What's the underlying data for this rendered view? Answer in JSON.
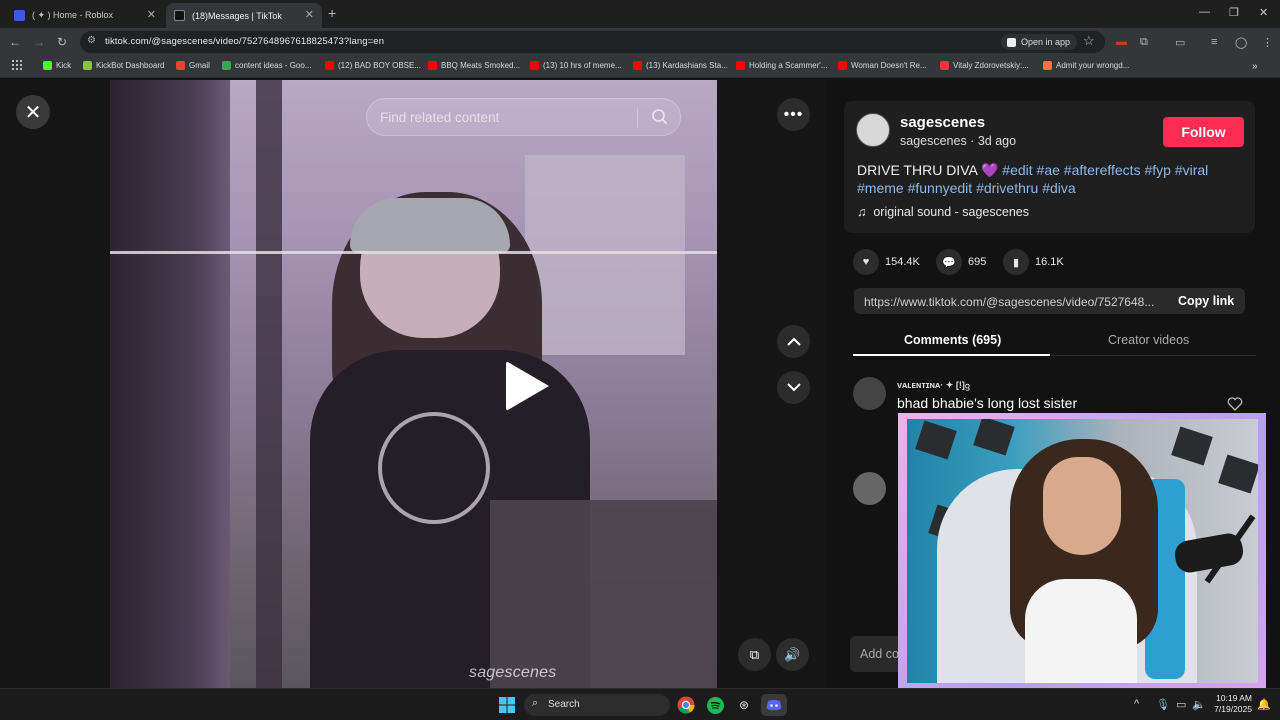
{
  "browser": {
    "tabs": [
      {
        "title": "( ✦ ) Home - Roblox",
        "active": false,
        "favicon_color": "#3b5bdb"
      },
      {
        "title": "(18)Messages | TikTok",
        "active": true,
        "favicon_color": "#111111"
      }
    ],
    "url": "tiktok.com/@sagescenes/video/7527648967618825473?lang=en",
    "open_in_app_label": "Open in app",
    "bookmarks": [
      {
        "label": "Kick",
        "color": "#53fc18"
      },
      {
        "label": "KickBot Dashboard",
        "color": "#8bc34a"
      },
      {
        "label": "Gmail",
        "color": "#ea4335"
      },
      {
        "label": "content ideas - Goo...",
        "color": "#34a853"
      },
      {
        "label": "(12) BAD BOY OBSE...",
        "color": "#ff0000"
      },
      {
        "label": "BBQ Meats Smoked...",
        "color": "#ff0000"
      },
      {
        "label": "(13) 10 hrs of meme...",
        "color": "#ff0000"
      },
      {
        "label": "(13) Kardashians Sta...",
        "color": "#ff0000"
      },
      {
        "label": "Holding a Scammer'...",
        "color": "#ff0000"
      },
      {
        "label": "Woman Doesn't Re...",
        "color": "#ff0000"
      },
      {
        "label": "Vitaly Zdorovetskiy:...",
        "color": "#e53935"
      },
      {
        "label": "Admit your wrongd...",
        "color": "#ff7043"
      }
    ]
  },
  "video": {
    "search_placeholder": "Find related content",
    "watermark": "sagescenes"
  },
  "post": {
    "author": "sagescenes",
    "handle_line": "sagescenes · 3d ago",
    "follow_label": "Follow",
    "caption": "DRIVE THRU DIVA 💜",
    "hashtags_line1": "#edit #ae #aftereffects #fyp #viral",
    "hashtags_line2": "#meme #funnyedit #drivethru #diva",
    "sound": "original sound - sagescenes",
    "likes": "154.4K",
    "comments_count": "695",
    "saves": "16.1K",
    "share_url": "https://www.tiktok.com/@sagescenes/video/7527648...",
    "copy_link_label": "Copy link",
    "tab_comments": "Comments (695)",
    "tab_creator": "Creator videos",
    "add_comment_placeholder": "Add co"
  },
  "comments": [
    {
      "name": "ᴠᴀʟᴇɴᴛɪɴᴀ· ✦ [!]ᦋ",
      "text": "bhad bhabie's long lost sister"
    }
  ],
  "taskbar": {
    "search_label": "Search",
    "time": "10:19 AM",
    "date": "7/19/2025"
  },
  "colors": {
    "accent": "#fe2c55",
    "hashtag": "#8fb8e8"
  }
}
